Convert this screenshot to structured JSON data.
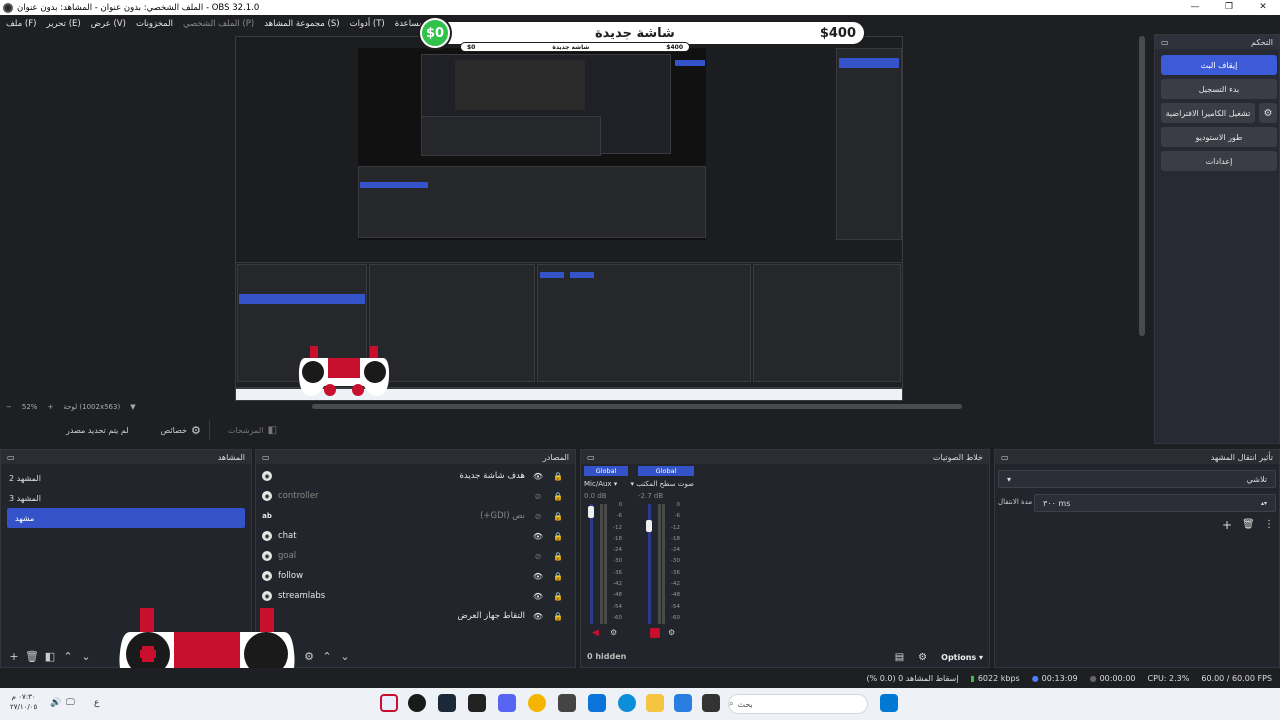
{
  "window": {
    "title": "OBS 32.1.0 - الملف الشخصي: بدون عنوان - المشاهد: بدون عنوان",
    "controls": [
      "—",
      "❐",
      "✕"
    ]
  },
  "menu": {
    "items": [
      "ملف (F)",
      "تحرير (E)",
      "عرض (V)",
      "المخزونات",
      "الملف الشخصي (P)",
      "مجموعة المشاهد (S)",
      "أدوات (T)",
      "مساعدة (H)"
    ]
  },
  "overlay": {
    "amount": "$0",
    "title": "شاشة جديدة",
    "goal": "$400",
    "nested_amount": "$0",
    "nested_title": "شاشة جديدة",
    "nested_goal": "$400"
  },
  "preview": {
    "zoom_minus": "−",
    "zoom": "52%",
    "zoom_plus": "+",
    "resolution": "لوحة (1002x563)"
  },
  "source_toolbar": {
    "no_source": "لم يتم تحديد مصدر",
    "properties": "خصائص",
    "filters": "المرشحات"
  },
  "controls_dock": {
    "title": "التحكم",
    "stop_stream": "إيقاف البث",
    "start_recording": "بدء التسجيل",
    "start_virtual_camera": "تشغيل الكاميرا الافتراضية",
    "studio_mode": "طور الاستوديو",
    "settings": "إعدادات"
  },
  "scenes": {
    "title": "المشاهد",
    "items": [
      "المشهد 2",
      "المشهد 3",
      "مشهد"
    ],
    "selected": "مشهد"
  },
  "sources": {
    "title": "المصادر",
    "items": [
      {
        "name": "هدف شاشة جديدة",
        "visible": true
      },
      {
        "name": "controller",
        "visible": false
      },
      {
        "name": "نص (GDI+)",
        "visible": false
      },
      {
        "name": "chat",
        "visible": true
      },
      {
        "name": "goal",
        "visible": false
      },
      {
        "name": "follow",
        "visible": true
      },
      {
        "name": "streamlabs",
        "visible": true
      },
      {
        "name": "التقاط جهاز العرض",
        "visible": true
      }
    ]
  },
  "mixer": {
    "title": "خلاط الصوتيات",
    "channels": [
      {
        "tag": "Global",
        "name": "Mic/Aux",
        "db": "0.0 dB"
      },
      {
        "tag": "Global",
        "name": "صوت سطح المكتب",
        "db": "-2.7 dB"
      }
    ],
    "scale": [
      "0",
      "-6",
      "-12",
      "-18",
      "-24",
      "-30",
      "-36",
      "-42",
      "-48",
      "-54",
      "-60"
    ],
    "hidden": "0 hidden",
    "options": "Options"
  },
  "transitions": {
    "title": "تأثير انتقال المشهد",
    "type": "تلاشي",
    "duration_label": "مدة الانتقال",
    "duration": "٣٠٠ ms"
  },
  "status": {
    "dropped": "إسقاط المشاهد 0 (0.0 %)",
    "bitrate": "6022 kbps",
    "stream_time": "00:13:09",
    "rec_time": "00:00:00",
    "cpu": "CPU: 2.3%",
    "fps": "60.00 / 60.00 FPS"
  },
  "taskbar": {
    "search": "بحث",
    "time": "٠٧:٣٠ م",
    "date": "٢٧/١٠/٠٥",
    "lang": "ع"
  },
  "colors": {
    "accent": "#3553c9",
    "goal_green": "#30c24a",
    "controller_red": "#c8102e"
  }
}
